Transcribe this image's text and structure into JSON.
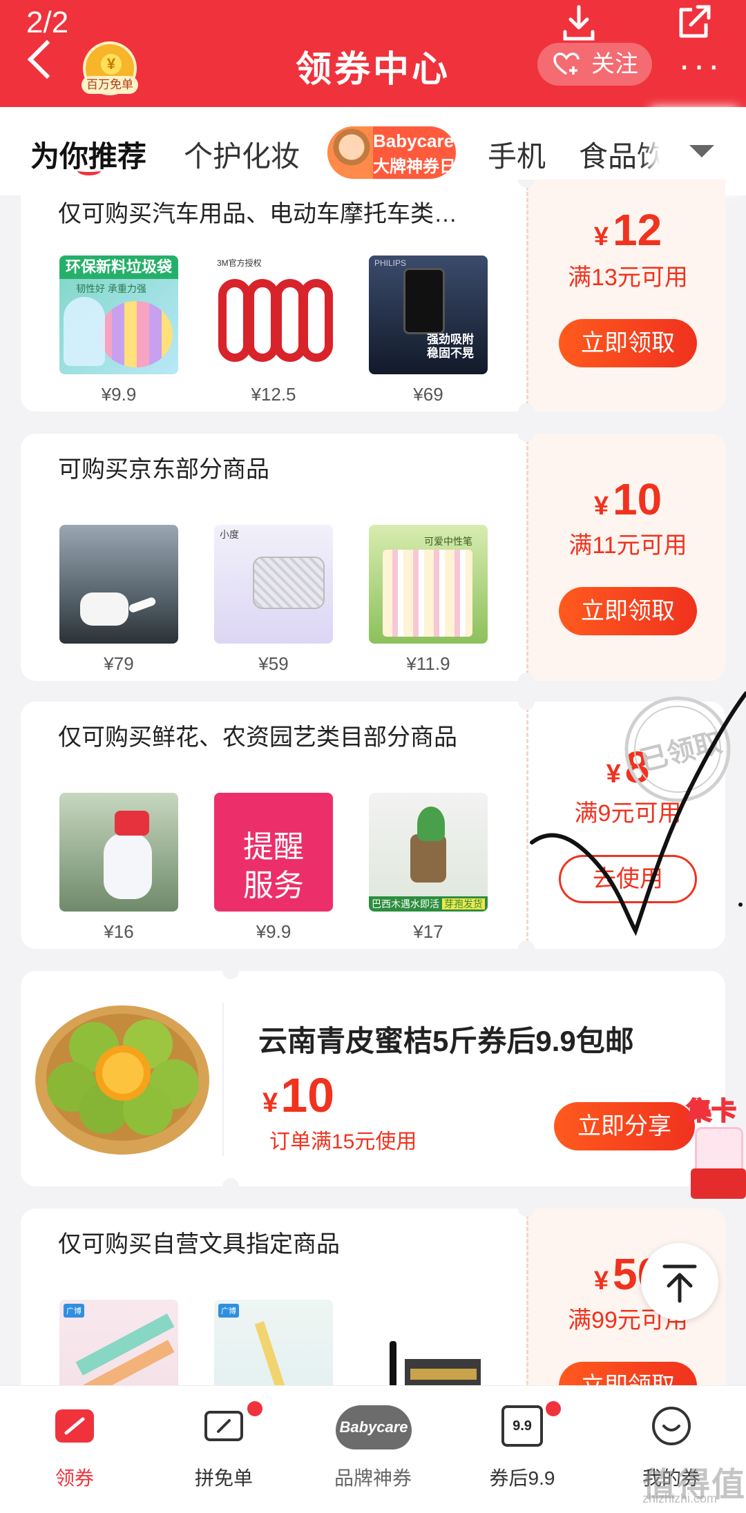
{
  "header": {
    "page_counter": "2/2",
    "badge_caption": "百万免单",
    "title": "领券中心",
    "follow_label": "关注"
  },
  "tabs": {
    "items": [
      "为你推荐",
      "个护化妆",
      "手机",
      "食品饮"
    ],
    "banner_line1": "Babycare",
    "banner_line2": "大牌神券日"
  },
  "coupons": [
    {
      "title": "仅可购买汽车用品、电动车摩托车类…",
      "products": [
        {
          "price": "¥9.9",
          "image_text": "环保新料垃圾袋",
          "image_sub": "韧性好 承重力强"
        },
        {
          "price": "¥12.5",
          "image_text": "3M官方授权",
          "image_sub": ""
        },
        {
          "price": "¥69",
          "image_text": "强劲吸附 稳固不晃",
          "image_sub": "PHILIPS"
        }
      ],
      "currency": "¥",
      "amount": "12",
      "condition": "满13元可用",
      "button": "立即领取"
    },
    {
      "title": "可购买京东部分商品",
      "products": [
        {
          "price": "¥79",
          "image_text": "",
          "image_sub": ""
        },
        {
          "price": "¥59",
          "image_text": "小度",
          "image_sub": ""
        },
        {
          "price": "¥11.9",
          "image_text": "可爱中性笔",
          "image_sub": ""
        }
      ],
      "currency": "¥",
      "amount": "10",
      "condition": "满11元可用",
      "button": "立即领取"
    },
    {
      "title": "仅可购买鲜花、农资园艺类目部分商品",
      "products": [
        {
          "price": "¥16",
          "image_text": "",
          "image_sub": ""
        },
        {
          "price": "¥9.9",
          "image_text": "提醒",
          "image_sub": "服务"
        },
        {
          "price": "¥17",
          "image_text": "巴西木遇水即活",
          "image_sub": "芽孢发货"
        }
      ],
      "currency": "¥",
      "amount": "8",
      "condition": "满9元可用",
      "button": "去使用",
      "stamp": "已领取"
    },
    {
      "title": "仅可购买自营文具指定商品",
      "products": [
        {
          "price": "",
          "image_text": "广博",
          "image_sub": ""
        },
        {
          "price": "",
          "image_text": "广博",
          "image_sub": ""
        },
        {
          "price": "",
          "image_text": "",
          "image_sub": ""
        }
      ],
      "currency": "¥",
      "amount": "50",
      "condition": "满99元可用",
      "button": "立即领取"
    }
  ],
  "feature": {
    "title": "云南青皮蜜桔5斤券后9.9包邮",
    "currency": "¥",
    "amount": "10",
    "condition": "订单满15元使用",
    "button": "立即分享"
  },
  "floating": {
    "jika_label": "集卡"
  },
  "bottom_nav": [
    {
      "label": "领券",
      "active": true
    },
    {
      "label": "拼免单",
      "active": false
    },
    {
      "label": "品牌神券",
      "active": false,
      "logo": "Babycare"
    },
    {
      "label": "券后9.9",
      "active": false,
      "icon_text": "9.9"
    },
    {
      "label": "我的券",
      "active": false
    }
  ],
  "watermark": {
    "main": "值得值",
    "sub": "zhizhizhi.com"
  },
  "colors": {
    "brand_red": "#f0323c",
    "coupon_red": "#f0321e",
    "panel_bg": "#fff5f0"
  }
}
